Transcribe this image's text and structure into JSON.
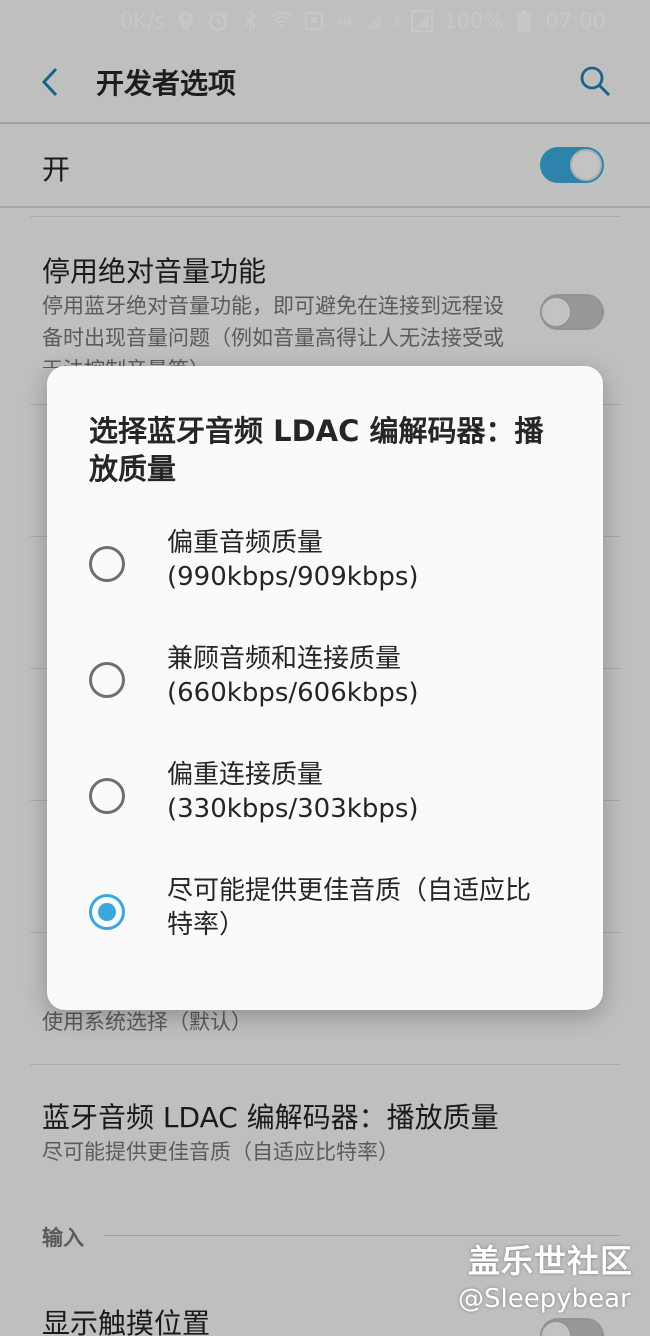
{
  "status_bar": {
    "net_speed": "0K/s",
    "signal_label_1": "4G",
    "signal_label_2": "E",
    "battery": "100%",
    "time": "07:00"
  },
  "app_bar": {
    "title": "开发者选项"
  },
  "master_switch": {
    "label": "开",
    "state": "on"
  },
  "settings": [
    {
      "title": "停用绝对音量功能",
      "subtitle": "停用蓝牙绝对音量功能，即可避免在连接到远程设备时出现音量问题（例如音量高得让人无法接受或无法控制音量等）",
      "toggle": "off"
    },
    {
      "title": "",
      "subtitle": "使用系统选择（默认）"
    },
    {
      "title": "蓝牙音频 LDAC 编解码器：播放质量",
      "subtitle": "尽可能提供更佳音质（自适应比特率）"
    }
  ],
  "section": {
    "header": "输入"
  },
  "next_setting": {
    "title": "显示触摸位置"
  },
  "dialog": {
    "title": "选择蓝牙音频 LDAC 编解码器：播放质量",
    "options": [
      {
        "label": "偏重音频质量 (990kbps/909kbps)",
        "selected": false
      },
      {
        "label": "兼顾音频和连接质量 (660kbps/606kbps)",
        "selected": false
      },
      {
        "label": "偏重连接质量 (330kbps/303kbps)",
        "selected": false
      },
      {
        "label": "尽可能提供更佳音质（自适应比特率）",
        "selected": true
      }
    ]
  },
  "watermark": {
    "line1": "盖乐世社区",
    "line2": "@Sleepybear"
  },
  "colors": {
    "accent": "#3aa8dc",
    "background": "#f5f5f5",
    "dialog": "#fafafa"
  }
}
